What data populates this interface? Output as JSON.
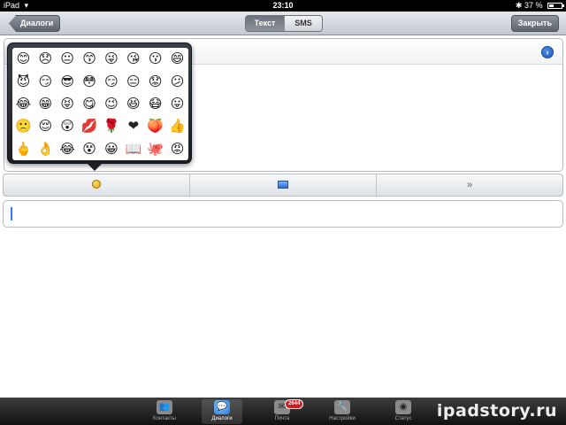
{
  "status_bar": {
    "carrier": "iPad",
    "wifi_icon": "▾",
    "time": "23:10",
    "bluetooth_icon": "✱",
    "battery_percent": "37 %",
    "battery_level": 0.37
  },
  "nav": {
    "back_label": "Диалоги",
    "segments": [
      "Текст",
      "SMS"
    ],
    "active_segment": "Текст",
    "close_label": "Закрыть"
  },
  "card": {
    "header_text": "",
    "go_icon": "›"
  },
  "emoji_panel": {
    "emojis": [
      "😊",
      "😞",
      "😐",
      "😙",
      "😜",
      "😘",
      "😗",
      "😄",
      "😈",
      "😏",
      "😎",
      "😳",
      "😏",
      "😑",
      "😟",
      "😕",
      "😂",
      "😁",
      "😝",
      "😋",
      "😉",
      "😆",
      "😷",
      "😛",
      "🙁",
      "😌",
      "😲",
      "💋",
      "🌹",
      "❤",
      "🍑",
      "👍",
      "🖕",
      "👌",
      "😂",
      "😵",
      "😀",
      "📖",
      "🐙",
      "😡"
    ]
  },
  "toolbar": {
    "smiley_icon": "smiley",
    "photo_icon": "photo",
    "more_icon": "»"
  },
  "tabbar": {
    "tabs": [
      {
        "label": "Контакты",
        "icon": "👥"
      },
      {
        "label": "Диалоги",
        "icon": "💬"
      },
      {
        "label": "Почта",
        "icon": "✉"
      },
      {
        "label": "Настройки",
        "icon": "🔧"
      },
      {
        "label": "Статус",
        "icon": "◉"
      }
    ],
    "active_tab": "Диалоги",
    "mail_badge": "2644",
    "watermark": "ipadstory.ru"
  }
}
